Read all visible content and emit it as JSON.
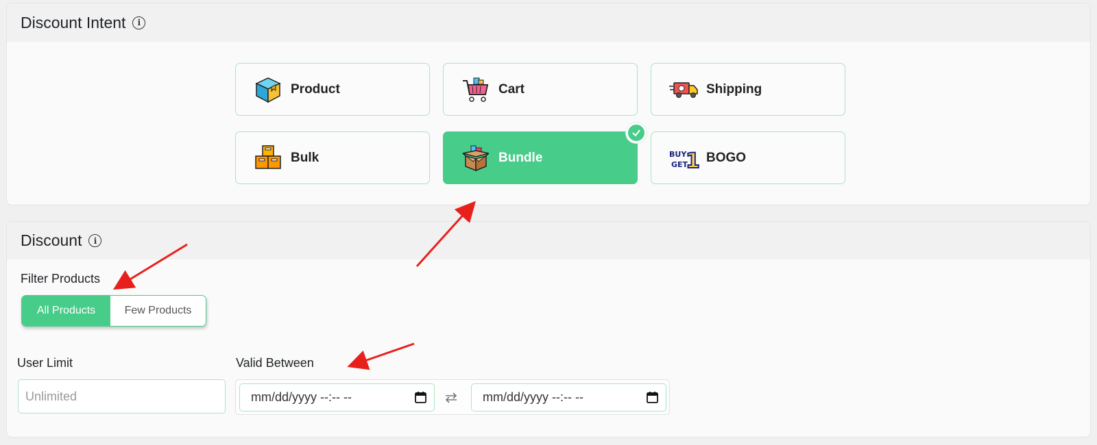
{
  "intent": {
    "title": "Discount Intent",
    "options": [
      {
        "label": "Product",
        "icon": "product-box-icon"
      },
      {
        "label": "Cart",
        "icon": "shopping-cart-icon"
      },
      {
        "label": "Shipping",
        "icon": "delivery-truck-icon"
      },
      {
        "label": "Bulk",
        "icon": "stacked-boxes-icon"
      },
      {
        "label": "Bundle",
        "icon": "open-bundle-box-icon"
      },
      {
        "label": "BOGO",
        "icon": "buy-get-one-icon"
      }
    ],
    "selected": "Bundle"
  },
  "bogo_icon": {
    "line1": "BUY",
    "line2": "GET",
    "num": "1"
  },
  "discount": {
    "title": "Discount",
    "filter_label": "Filter Products",
    "filter_options": [
      "All Products",
      "Few Products"
    ],
    "filter_selected": "All Products",
    "user_limit_label": "User Limit",
    "user_limit_placeholder": "Unlimited",
    "valid_label": "Valid Between",
    "date_start_placeholder": "mm/dd/yyyy --:-- --",
    "date_end_placeholder": "mm/dd/yyyy --:-- --"
  },
  "colors": {
    "accent": "#48cc89",
    "card_border": "#a8e6c5",
    "arrow": "#e8201c"
  }
}
